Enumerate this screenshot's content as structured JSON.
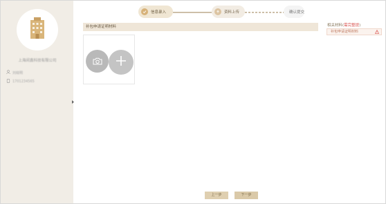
{
  "sidebar": {
    "company_name": "上海闵鑫科技有限公司",
    "username": "刘晓明",
    "phone": "1701234565"
  },
  "stepper": {
    "steps": [
      {
        "label": "信息录入"
      },
      {
        "label": "资料上传"
      },
      {
        "label": "确认提交"
      }
    ]
  },
  "main": {
    "section_title": "补包申请证明材料"
  },
  "related": {
    "title_prefix": "相关材料(",
    "title_required": "需完整提",
    "title_suffix": ")",
    "items": [
      {
        "label": "补包申请证明材料"
      }
    ]
  },
  "footer": {
    "prev_label": "上一步",
    "next_label": "下一步"
  },
  "colors": {
    "sidebar_bg": "#f1ede6",
    "accent": "#d7b27a",
    "button_bg": "#dfcfb0",
    "required": "#d9534f"
  }
}
